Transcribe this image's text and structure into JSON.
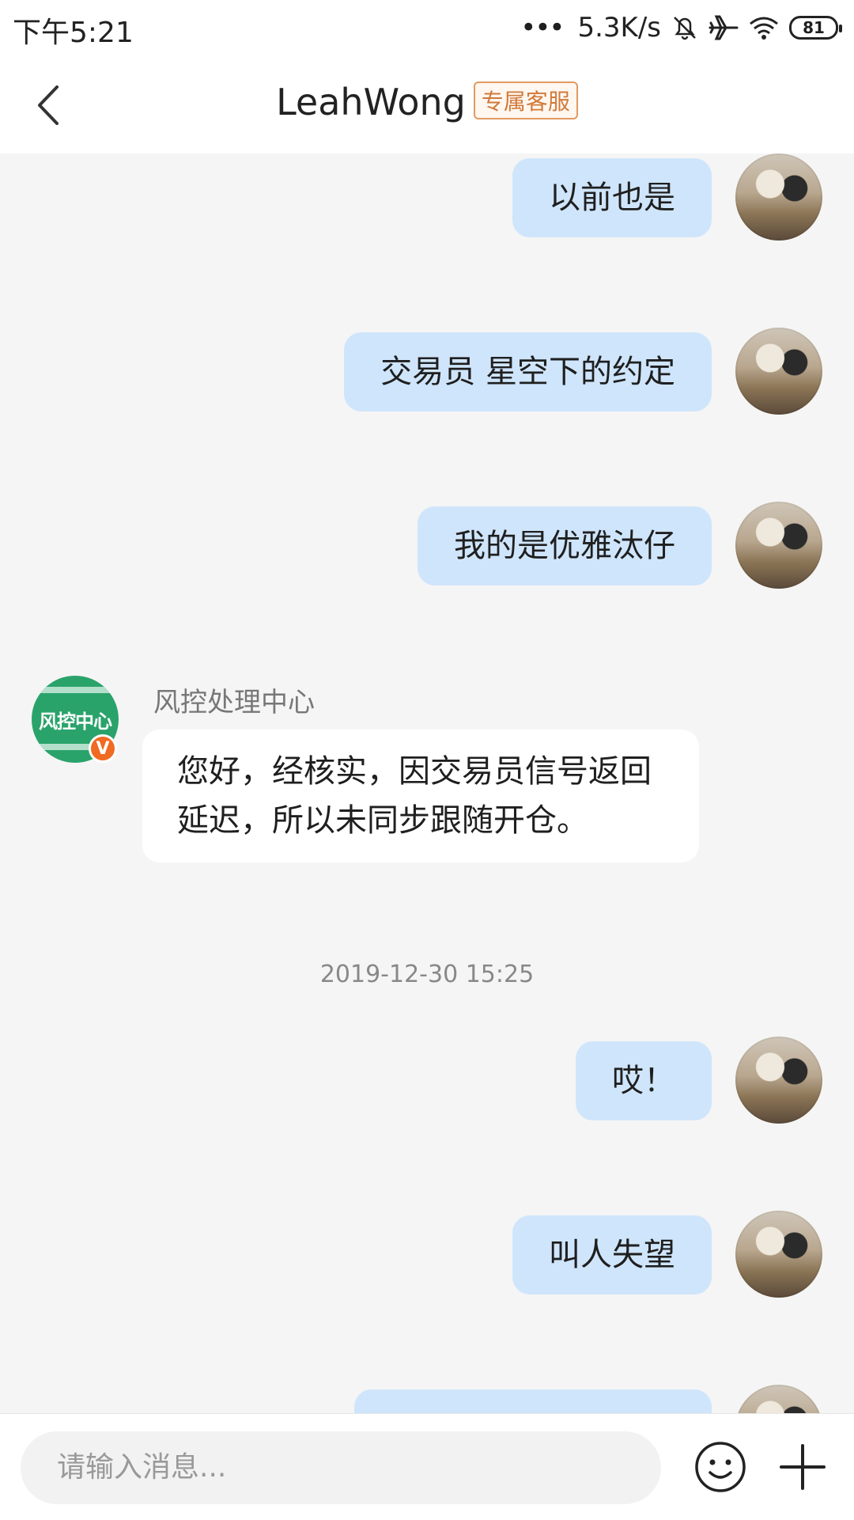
{
  "status_bar": {
    "time": "下午5:21",
    "dots": "•••",
    "speed": "5.3K/s",
    "battery": "81"
  },
  "header": {
    "title": "LeahWong",
    "badge": "专属客服"
  },
  "messages": [
    {
      "type": "me",
      "text": "以前也是"
    },
    {
      "type": "me",
      "text": "交易员 星空下的约定"
    },
    {
      "type": "me",
      "text": "我的是优雅汰仔"
    },
    {
      "type": "other",
      "sender": "风控处理中心",
      "avatar_label": "风控中心",
      "badge": "V",
      "text": "您好，经核实，因交易员信号返回延迟，所以未同步跟随开仓。"
    },
    {
      "type": "time",
      "text": "2019-12-30 15:25"
    },
    {
      "type": "me",
      "text": "哎！"
    },
    {
      "type": "me",
      "text": "叫人失望"
    }
  ],
  "input": {
    "placeholder": "请输入消息..."
  },
  "colors": {
    "bubble_me": "#cfe5fb",
    "bubble_other": "#ffffff",
    "badge_accent": "#f06a21",
    "avatar_other": "#2aa36b"
  },
  "icons": [
    "back-arrow-icon",
    "more-dots-icon",
    "mute-bell-icon",
    "airplane-icon",
    "wifi-icon",
    "battery-icon",
    "emoji-icon",
    "plus-icon"
  ]
}
